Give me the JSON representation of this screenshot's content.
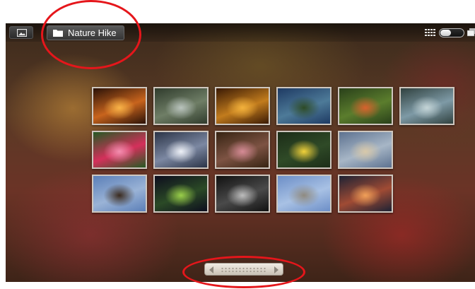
{
  "header": {
    "album_title": "Nature Hike"
  },
  "icons": {
    "gallery": "picture-icon",
    "album": "folder-icon",
    "grid_view": "grid-icon",
    "stack_view": "stack-icon",
    "scroll_left": "arrow-left-icon",
    "scroll_right": "arrow-right-icon"
  },
  "view_toggle": {
    "selected": "grid"
  },
  "thumbnails": [
    {
      "label": "cave-fire",
      "colors": [
        "#2a1208",
        "#c8641d",
        "#f7b348"
      ]
    },
    {
      "label": "waterfall",
      "colors": [
        "#2f3b2c",
        "#6f7e66",
        "#b9c3bd"
      ]
    },
    {
      "label": "autumn-leaves",
      "colors": [
        "#3a1a05",
        "#c27c1d",
        "#f2b13c"
      ]
    },
    {
      "label": "palm-trees",
      "colors": [
        "#1e3a63",
        "#4d7a98",
        "#2d4a25"
      ]
    },
    {
      "label": "orange-flowers",
      "colors": [
        "#29401a",
        "#5b7d2d",
        "#d8612d"
      ]
    },
    {
      "label": "succulent",
      "colors": [
        "#30413f",
        "#7e9aa6",
        "#c4d4d6"
      ]
    },
    {
      "label": "red-lily",
      "colors": [
        "#245a23",
        "#d4305b",
        "#f38fb0"
      ]
    },
    {
      "label": "sunburst",
      "colors": [
        "#2b3447",
        "#7c88a2",
        "#eef1f7"
      ]
    },
    {
      "label": "pink-lily",
      "colors": [
        "#372413",
        "#7d5343",
        "#d58b96"
      ]
    },
    {
      "label": "yellow-hibiscus",
      "colors": [
        "#1c2d18",
        "#2f4a27",
        "#f1d13a"
      ]
    },
    {
      "label": "beach",
      "colors": [
        "#5d7290",
        "#a7b6c6",
        "#d8c8a9"
      ]
    },
    {
      "label": "church",
      "colors": [
        "#5b7fb8",
        "#9ab3d6",
        "#3a2a1e"
      ]
    },
    {
      "label": "night-plant",
      "colors": [
        "#0d0d1e",
        "#2b4a26",
        "#9acf4a"
      ]
    },
    {
      "label": "tunnel",
      "colors": [
        "#111111",
        "#4a4a4a",
        "#bdbdbd"
      ]
    },
    {
      "label": "street-sign",
      "colors": [
        "#6c8ec7",
        "#a8c1e4",
        "#8f8a80"
      ]
    },
    {
      "label": "sunset-city",
      "colors": [
        "#1d2234",
        "#a04b34",
        "#f0a059"
      ]
    }
  ],
  "annotations": [
    "callout-album-title",
    "callout-scrubber"
  ]
}
